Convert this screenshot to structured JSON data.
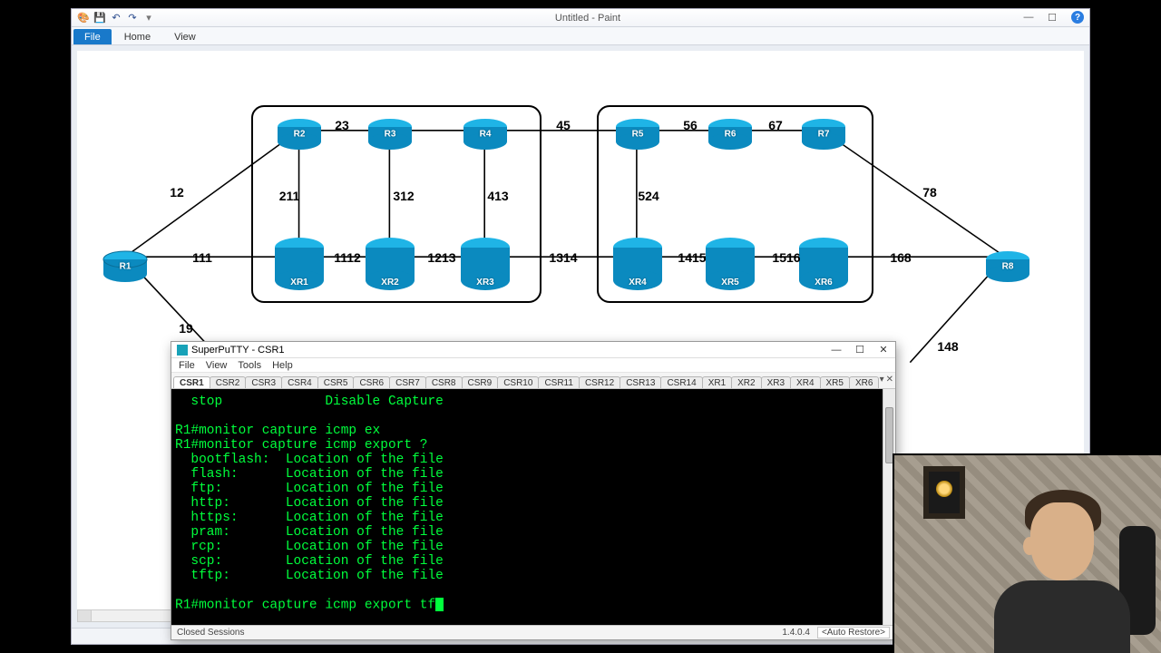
{
  "paint": {
    "title": "Untitled - Paint",
    "tabs": {
      "file": "File",
      "home": "Home",
      "view": "View"
    }
  },
  "diagram": {
    "routers_top": [
      "R1",
      "R2",
      "R3",
      "R4",
      "R5",
      "R6",
      "R7",
      "R8"
    ],
    "routers_bottom": [
      "XR1",
      "XR2",
      "XR3",
      "XR4",
      "XR5",
      "XR6"
    ],
    "labels": {
      "l12": "12",
      "l23": "23",
      "l45": "45",
      "l56": "56",
      "l67": "67",
      "l78": "78",
      "l211": "211",
      "l312": "312",
      "l413": "413",
      "l524": "524",
      "l111": "111",
      "l1112": "1112",
      "l1213": "1213",
      "l1314": "1314",
      "l1415": "1415",
      "l1516": "1516",
      "l168": "168",
      "l19": "19",
      "l148": "148"
    }
  },
  "putty": {
    "title": "SuperPuTTY - CSR1",
    "menu": [
      "File",
      "View",
      "Tools",
      "Help"
    ],
    "tabs": [
      "CSR1",
      "CSR2",
      "CSR3",
      "CSR4",
      "CSR5",
      "CSR6",
      "CSR7",
      "CSR8",
      "CSR9",
      "CSR10",
      "CSR11",
      "CSR12",
      "CSR13",
      "CSR14",
      "XR1",
      "XR2",
      "XR3",
      "XR4",
      "XR5",
      "XR6"
    ],
    "text": "  stop             Disable Capture\n\nR1#monitor capture icmp ex\nR1#monitor capture icmp export ?\n  bootflash:  Location of the file\n  flash:      Location of the file\n  ftp:        Location of the file\n  http:       Location of the file\n  https:      Location of the file\n  pram:       Location of the file\n  rcp:        Location of the file\n  scp:        Location of the file\n  tftp:       Location of the file\n\nR1#monitor capture icmp export tf",
    "status_left": "Closed Sessions",
    "status_ver": "1.4.0.4",
    "status_right": "<Auto Restore>"
  }
}
